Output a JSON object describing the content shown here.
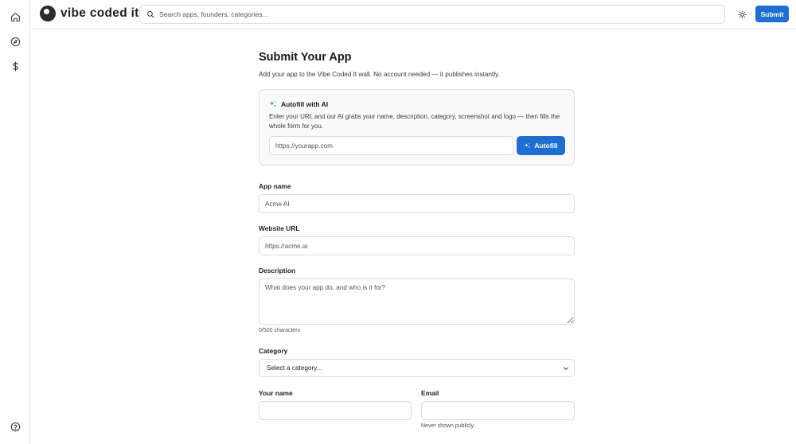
{
  "brand": {
    "name": "vibe coded it"
  },
  "search": {
    "placeholder": "Search apps, founders, categories..."
  },
  "header": {
    "submit_label": "Submit"
  },
  "page": {
    "title": "Submit Your App",
    "subtitle": "Add your app to the Vibe Coded It wall. No account needed — it publishes instantly."
  },
  "autofill": {
    "title": "Autofill with AI",
    "description": "Enter your URL and our AI grabs your name, description, category, screenshot and logo — then fills the whole form for you.",
    "url_placeholder": "https://yourapp.com",
    "button_label": "Autofill"
  },
  "form": {
    "app_name": {
      "label": "App name",
      "placeholder": "Acme AI"
    },
    "website_url": {
      "label": "Website URL",
      "placeholder": "https://acme.ai"
    },
    "description": {
      "label": "Description",
      "placeholder": "What does your app do, and who is it for?",
      "counter": "0/500 characters"
    },
    "category": {
      "label": "Category",
      "selected": "Select a category..."
    },
    "your_name": {
      "label": "Your name",
      "value": ""
    },
    "email": {
      "label": "Email",
      "value": "",
      "hint": "Never shown publicly."
    }
  },
  "colors": {
    "accent": "#1f6fd1",
    "border": "#dcdcdc",
    "card_bg": "#fafafa"
  },
  "icons": {
    "rail": [
      "home-icon",
      "compass-icon",
      "dollar-icon",
      "help-icon"
    ],
    "search": "search-icon",
    "theme": "sun-icon",
    "ai": "sparkles-icon"
  }
}
